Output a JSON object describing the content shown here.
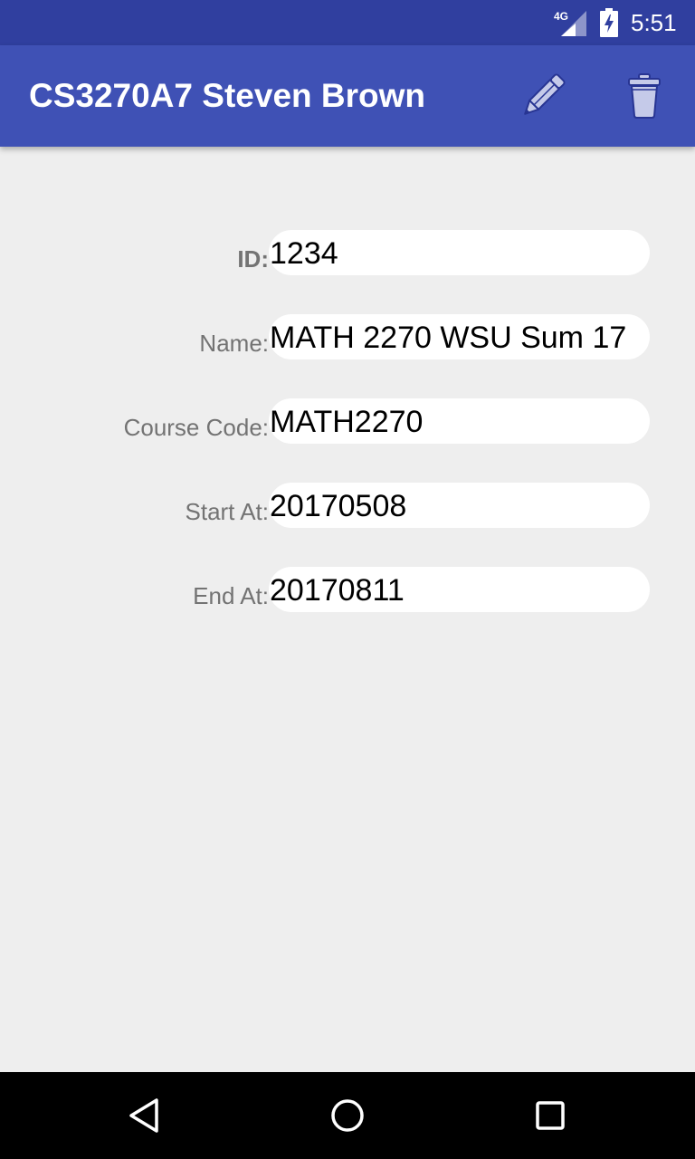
{
  "status_bar": {
    "network": "4G",
    "time": "5:51",
    "icons": [
      "signal-icon",
      "battery-charging-icon"
    ]
  },
  "app_bar": {
    "title": "CS3270A7 Steven Brown",
    "actions": [
      {
        "name": "edit",
        "icon": "pencil-icon"
      },
      {
        "name": "delete",
        "icon": "trash-icon"
      }
    ]
  },
  "form": {
    "fields": [
      {
        "label": "ID:",
        "value": "1234"
      },
      {
        "label": "Name:",
        "value": "MATH 2270 WSU Sum 17"
      },
      {
        "label": "Course Code:",
        "value": "MATH2270"
      },
      {
        "label": "Start At:",
        "value": "20170508"
      },
      {
        "label": "End At:",
        "value": "20170811"
      }
    ]
  },
  "nav_bar": {
    "icons": [
      "back-icon",
      "home-icon",
      "recents-icon"
    ]
  },
  "colors": {
    "status_bar": "#303f9f",
    "app_bar": "#3f51b5",
    "background": "#eeeeee",
    "label_text": "#737373",
    "icon_fill": "#c5cae9"
  }
}
